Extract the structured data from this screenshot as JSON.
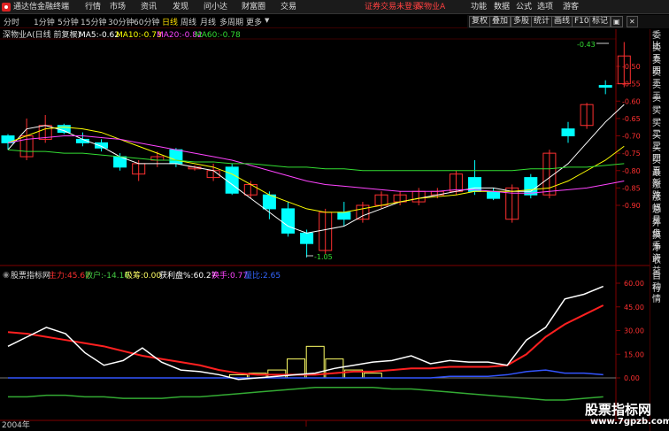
{
  "window": {
    "app_title": "通达信金融终端",
    "menus": [
      "行情",
      "市场",
      "资讯",
      "发现",
      "问小达",
      "财富圈",
      "交易"
    ],
    "login_alert": "证券交易未登录",
    "stock_tag": "深物业A",
    "right_menus": [
      "功能",
      "数据",
      "公式",
      "选项"
    ],
    "user": "游客"
  },
  "periods": [
    "分时",
    "1分钟",
    "5分钟",
    "15分钟",
    "30分钟",
    "60分钟",
    "日线",
    "周线",
    "月线",
    "多周期",
    "更多"
  ],
  "active_period": "日线",
  "toolbar": [
    "复权",
    "叠加",
    "多股",
    "统计",
    "画线",
    "F10",
    "标记"
  ],
  "main_chart": {
    "title": "深物业A(日线 前复权)",
    "ma": [
      {
        "name": "MA5",
        "value": "-0.62",
        "color": "#ffffff"
      },
      {
        "name": "MA10",
        "value": "-0.73",
        "color": "#ffff00"
      },
      {
        "name": "MA20",
        "value": "-0.82",
        "color": "#ff44ff"
      },
      {
        "name": "MA60",
        "value": "-0.78",
        "color": "#33dd33"
      }
    ],
    "yticks": [
      "-0.50",
      "-0.55",
      "-0.60",
      "-0.65",
      "-0.70",
      "-0.75",
      "-0.80",
      "-0.85",
      "-0.90"
    ],
    "high_label": "-0.43",
    "low_label": "-1.05"
  },
  "candles": [
    {
      "o": -0.72,
      "c": -0.7,
      "h": -0.695,
      "l": -0.74,
      "up": false
    },
    {
      "o": -0.7,
      "c": -0.76,
      "h": -0.65,
      "l": -0.77,
      "up": true
    },
    {
      "o": -0.67,
      "c": -0.71,
      "h": -0.64,
      "l": -0.72,
      "up": true
    },
    {
      "o": -0.67,
      "c": -0.69,
      "h": -0.665,
      "l": -0.695,
      "up": false
    },
    {
      "o": -0.71,
      "c": -0.72,
      "h": -0.69,
      "l": -0.73,
      "up": false
    },
    {
      "o": -0.72,
      "c": -0.735,
      "h": -0.71,
      "l": -0.745,
      "up": false
    },
    {
      "o": -0.76,
      "c": -0.79,
      "h": -0.75,
      "l": -0.8,
      "up": false
    },
    {
      "o": -0.78,
      "c": -0.81,
      "h": -0.77,
      "l": -0.83,
      "up": true
    },
    {
      "o": -0.76,
      "c": -0.77,
      "h": -0.745,
      "l": -0.79,
      "up": true
    },
    {
      "o": -0.74,
      "c": -0.78,
      "h": -0.735,
      "l": -0.79,
      "up": false
    },
    {
      "o": -0.79,
      "c": -0.795,
      "h": -0.785,
      "l": -0.8,
      "up": true
    },
    {
      "o": -0.8,
      "c": -0.82,
      "h": -0.78,
      "l": -0.83,
      "up": true
    },
    {
      "o": -0.79,
      "c": -0.865,
      "h": -0.78,
      "l": -0.87,
      "up": false
    },
    {
      "o": -0.84,
      "c": -0.87,
      "h": -0.83,
      "l": -0.88,
      "up": true
    },
    {
      "o": -0.87,
      "c": -0.91,
      "h": -0.86,
      "l": -0.94,
      "up": false
    },
    {
      "o": -0.91,
      "c": -0.98,
      "h": -0.89,
      "l": -0.99,
      "up": false
    },
    {
      "o": -0.98,
      "c": -1.01,
      "h": -0.97,
      "l": -1.05,
      "up": false
    },
    {
      "o": -1.03,
      "c": -0.92,
      "h": -0.91,
      "l": -1.04,
      "up": true
    },
    {
      "o": -0.92,
      "c": -0.94,
      "h": -0.89,
      "l": -0.96,
      "up": false
    },
    {
      "o": -0.94,
      "c": -0.9,
      "h": -0.89,
      "l": -0.95,
      "up": true
    },
    {
      "o": -0.9,
      "c": -0.87,
      "h": -0.86,
      "l": -0.91,
      "up": true
    },
    {
      "o": -0.89,
      "c": -0.87,
      "h": -0.86,
      "l": -0.9,
      "up": true
    },
    {
      "o": -0.89,
      "c": -0.86,
      "h": -0.85,
      "l": -0.9,
      "up": true
    },
    {
      "o": -0.87,
      "c": -0.86,
      "h": -0.85,
      "l": -0.88,
      "up": true
    },
    {
      "o": -0.86,
      "c": -0.81,
      "h": -0.8,
      "l": -0.87,
      "up": true
    },
    {
      "o": -0.82,
      "c": -0.86,
      "h": -0.77,
      "l": -0.87,
      "up": false
    },
    {
      "o": -0.86,
      "c": -0.88,
      "h": -0.85,
      "l": -0.885,
      "up": false
    },
    {
      "o": -0.85,
      "c": -0.94,
      "h": -0.84,
      "l": -0.95,
      "up": true
    },
    {
      "o": -0.82,
      "c": -0.87,
      "h": -0.81,
      "l": -0.88,
      "up": false
    },
    {
      "o": -0.87,
      "c": -0.75,
      "h": -0.74,
      "l": -0.88,
      "up": true
    },
    {
      "o": -0.68,
      "c": -0.7,
      "h": -0.66,
      "l": -0.72,
      "up": false
    },
    {
      "o": -0.67,
      "c": -0.61,
      "h": -0.605,
      "l": -0.68,
      "up": true
    },
    {
      "o": -0.56,
      "c": -0.555,
      "h": -0.54,
      "l": -0.58,
      "up": false
    },
    {
      "o": -0.55,
      "c": -0.47,
      "h": -0.43,
      "l": -0.56,
      "up": true
    }
  ],
  "ma_series": {
    "ma5": [
      -0.74,
      -0.68,
      -0.67,
      -0.685,
      -0.71,
      -0.73,
      -0.76,
      -0.78,
      -0.78,
      -0.78,
      -0.79,
      -0.8,
      -0.84,
      -0.88,
      -0.92,
      -0.96,
      -0.98,
      -0.97,
      -0.96,
      -0.93,
      -0.91,
      -0.89,
      -0.88,
      -0.87,
      -0.86,
      -0.85,
      -0.85,
      -0.86,
      -0.86,
      -0.82,
      -0.78,
      -0.72,
      -0.66,
      -0.61
    ],
    "ma10": [
      -0.72,
      -0.7,
      -0.68,
      -0.675,
      -0.68,
      -0.69,
      -0.71,
      -0.73,
      -0.75,
      -0.77,
      -0.78,
      -0.79,
      -0.81,
      -0.84,
      -0.87,
      -0.89,
      -0.91,
      -0.92,
      -0.92,
      -0.91,
      -0.9,
      -0.89,
      -0.88,
      -0.875,
      -0.87,
      -0.86,
      -0.86,
      -0.86,
      -0.855,
      -0.85,
      -0.83,
      -0.8,
      -0.77,
      -0.73
    ],
    "ma20": [
      -0.72,
      -0.71,
      -0.705,
      -0.7,
      -0.7,
      -0.705,
      -0.71,
      -0.72,
      -0.73,
      -0.74,
      -0.75,
      -0.76,
      -0.77,
      -0.785,
      -0.8,
      -0.815,
      -0.83,
      -0.84,
      -0.845,
      -0.85,
      -0.855,
      -0.86,
      -0.86,
      -0.86,
      -0.855,
      -0.855,
      -0.86,
      -0.865,
      -0.865,
      -0.86,
      -0.855,
      -0.85,
      -0.84,
      -0.83
    ],
    "ma60": [
      -0.74,
      -0.745,
      -0.745,
      -0.75,
      -0.75,
      -0.755,
      -0.76,
      -0.765,
      -0.77,
      -0.77,
      -0.775,
      -0.775,
      -0.78,
      -0.78,
      -0.785,
      -0.79,
      -0.79,
      -0.795,
      -0.795,
      -0.8,
      -0.8,
      -0.8,
      -0.8,
      -0.8,
      -0.8,
      -0.8,
      -0.8,
      -0.8,
      -0.795,
      -0.795,
      -0.79,
      -0.79,
      -0.785,
      -0.78
    ]
  },
  "indicator": {
    "name": "股票指标网",
    "items": [
      {
        "label": "主力:",
        "value": "45.67",
        "color": "#ff3030"
      },
      {
        "label": "散户:",
        "value": "-14.16",
        "color": "#44cc44"
      },
      {
        "label": "吸筹:",
        "value": "0.00",
        "color": "#ffff66"
      },
      {
        "label": "获利盘%:",
        "value": "60.27",
        "color": "#ffffff"
      },
      {
        "label": "换手:",
        "value": "0.77",
        "color": "#ff44ff"
      },
      {
        "label": "量比:",
        "value": "2.65",
        "color": "#3366ff"
      }
    ],
    "yticks": [
      "60.00",
      "45.00",
      "30.00",
      "15.00",
      "0.00"
    ],
    "white": [
      20,
      26,
      32,
      28,
      16,
      8,
      11,
      19,
      10,
      5,
      4,
      2,
      -1,
      0,
      1,
      2,
      3,
      6,
      8,
      10,
      11,
      14,
      9,
      11,
      10,
      10,
      8,
      24,
      32,
      50,
      53,
      58
    ],
    "red": [
      29,
      28,
      26,
      24,
      22,
      20,
      17,
      14,
      12,
      10,
      8,
      5,
      3,
      2,
      2,
      2,
      2,
      3,
      4,
      4,
      5,
      6,
      6,
      7,
      7,
      7,
      8,
      15,
      26,
      34,
      40,
      46
    ],
    "blue": [
      0,
      0,
      0,
      0,
      0,
      0,
      0,
      0,
      0,
      0,
      0,
      0,
      0,
      0,
      0,
      0,
      0,
      0,
      0,
      0,
      0,
      0,
      0,
      1,
      1,
      1,
      2,
      4,
      5,
      3,
      3,
      2
    ],
    "green": [
      -12,
      -12,
      -11,
      -11,
      -12,
      -12,
      -13,
      -13,
      -13,
      -12,
      -12,
      -11,
      -10,
      -9,
      -8,
      -7,
      -6,
      -6,
      -6,
      -6,
      -7,
      -7,
      -8,
      -9,
      -10,
      -11,
      -12,
      -13,
      -14,
      -14,
      -13,
      -12
    ],
    "yellow_bars": [
      0,
      0,
      0,
      0,
      0,
      0,
      0,
      0,
      0,
      0,
      0,
      0,
      2,
      3,
      5,
      12,
      20,
      12,
      5,
      3,
      0,
      0,
      0,
      0,
      0,
      0,
      0,
      0,
      0,
      0,
      0,
      0
    ],
    "ylim": [
      -20,
      65
    ]
  },
  "date_label": "2004年",
  "side_panel": [
    "委比",
    "卖五",
    "卖四",
    "卖三",
    "卖二",
    "卖一",
    "买一",
    "买二",
    "买三",
    "买四",
    "买五",
    "最新",
    "涨跌",
    "涨幅",
    "总量",
    "外盘",
    "换手",
    "净资",
    "收益"
  ],
  "side_bottom": [
    "自动",
    "行情"
  ],
  "watermark": {
    "title": "股票指标网",
    "url": "www.7gpzb.com"
  },
  "colors": {
    "up": "#ff3030",
    "down": "#00ffff",
    "axis": "#800000"
  }
}
